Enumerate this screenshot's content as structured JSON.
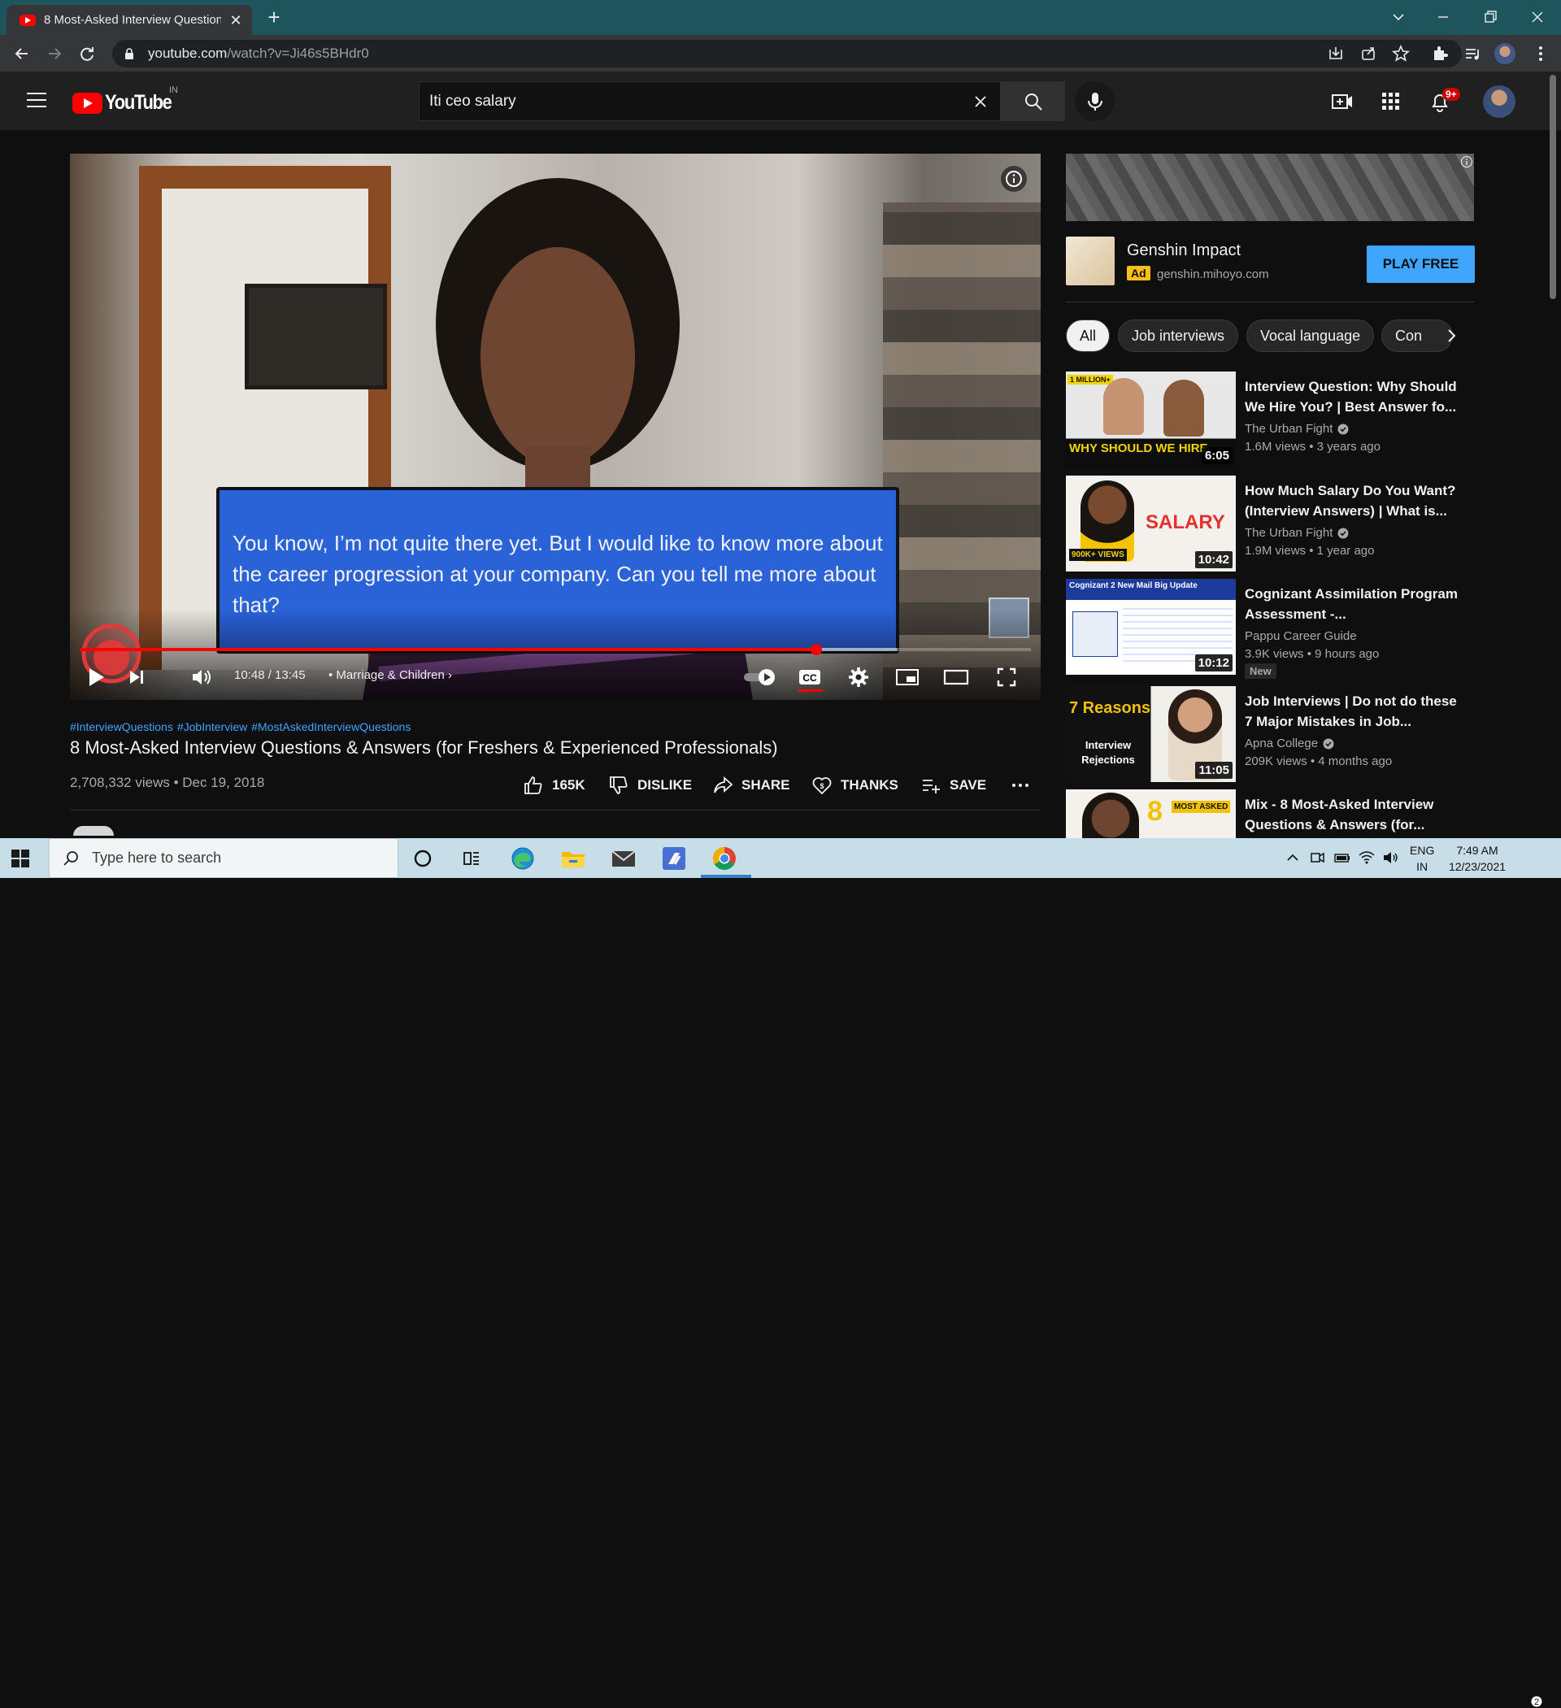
{
  "browser": {
    "tab_title": "8 Most-Asked Interview Question",
    "url_host": "youtube.com",
    "url_path": "/watch?v=Ji46s5BHdr0"
  },
  "masthead": {
    "logo_text": "YouTube",
    "region": "IN",
    "search_value": "Iti ceo salary",
    "notification_count": "9+"
  },
  "player": {
    "caption": "You know, I’m not quite there yet. But I would like to know more about the career progression at your company. Can you tell me more about that?",
    "time": "10:48 / 13:45",
    "chapter": "Marriage & Children",
    "progress_played": 0.774,
    "progress_loaded": 0.86
  },
  "video": {
    "hashtags": [
      "#InterviewQuestions",
      "#JobInterview",
      "#MostAskedInterviewQuestions"
    ],
    "title": "8 Most-Asked Interview Questions & Answers (for Freshers & Experienced Professionals)",
    "views_date": "2,708,332 views • Dec 19, 2018",
    "actions": {
      "like": "165K",
      "dislike": "DISLIKE",
      "share": "SHARE",
      "thanks": "THANKS",
      "save": "SAVE"
    }
  },
  "ad": {
    "title": "Genshin Impact",
    "badge": "Ad",
    "domain": "genshin.mihoyo.com",
    "cta": "PLAY FREE"
  },
  "chips": [
    "All",
    "Job interviews",
    "Vocal language",
    "Con"
  ],
  "recommendations": [
    {
      "title": "Interview Question: Why Should We Hire You? | Best Answer fo...",
      "channel": "The Urban Fight",
      "verified": true,
      "meta": "1.6M views • 3 years ago",
      "duration": "6:05",
      "thumb_text": "WHY SHOULD WE HIRE",
      "thumb_badge": "1 MILLION+",
      "new": ""
    },
    {
      "title": "How Much Salary Do You Want? (Interview Answers) | What is...",
      "channel": "The Urban Fight",
      "verified": true,
      "meta": "1.9M views • 1 year ago",
      "duration": "10:42",
      "thumb_text": "SALARY",
      "thumb_badge": "900K+ VIEWS",
      "new": ""
    },
    {
      "title": "Cognizant Assimilation Program Assessment -...",
      "channel": "Pappu Career Guide",
      "verified": false,
      "meta": "3.9K views • 9 hours ago",
      "duration": "10:12",
      "thumb_text": "Cognizant 2 New Mail Big Update",
      "thumb_badge": "",
      "new": "New"
    },
    {
      "title": "Job Interviews | Do not do these 7 Major Mistakes in Job...",
      "channel": "Apna College",
      "verified": true,
      "meta": "209K views • 4 months ago",
      "duration": "11:05",
      "thumb_text": "7 Reasons",
      "thumb_badge": "Interview Rejections",
      "new": ""
    },
    {
      "title": "Mix - 8 Most-Asked Interview Questions & Answers (for...",
      "channel": "",
      "verified": false,
      "meta": "",
      "duration": "",
      "thumb_text": "8",
      "thumb_badge": "MOST ASKED",
      "new": ""
    }
  ],
  "taskbar": {
    "search_placeholder": "Type here to search",
    "lang_top": "ENG",
    "lang_bottom": "IN",
    "time": "7:49 AM",
    "date": "12/23/2021",
    "notif_count": "2"
  },
  "colors": {
    "accent_red": "#ff0000",
    "link_blue": "#3ea6ff",
    "caption_blue": "#2a62d8",
    "ad_yellow": "#f9bd1c"
  }
}
